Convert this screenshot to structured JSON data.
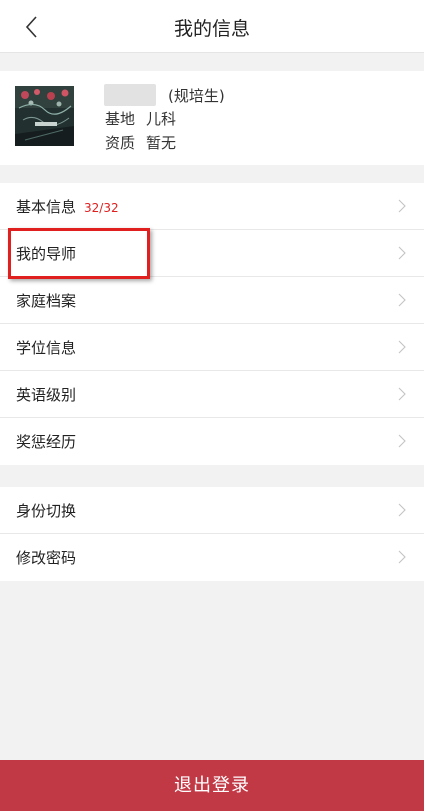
{
  "header": {
    "title": "我的信息",
    "back_icon": "chevron-left-icon"
  },
  "profile": {
    "rank": "(规培生)",
    "base_label": "基地",
    "base_value": "儿科",
    "qualification_label": "资质",
    "qualification_value": "暂无"
  },
  "menu_group_1": [
    {
      "label": "基本信息",
      "count": "32/32"
    },
    {
      "label": "我的导师"
    },
    {
      "label": "家庭档案"
    },
    {
      "label": "学位信息"
    },
    {
      "label": "英语级别"
    },
    {
      "label": "奖惩经历"
    }
  ],
  "menu_group_2": [
    {
      "label": "身份切换"
    },
    {
      "label": "修改密码"
    }
  ],
  "logout_label": "退出登录",
  "colors": {
    "accent_red": "#c23946",
    "count_red": "#e01f1f",
    "highlight": "#e0201e",
    "background": "#f2f2f2"
  }
}
